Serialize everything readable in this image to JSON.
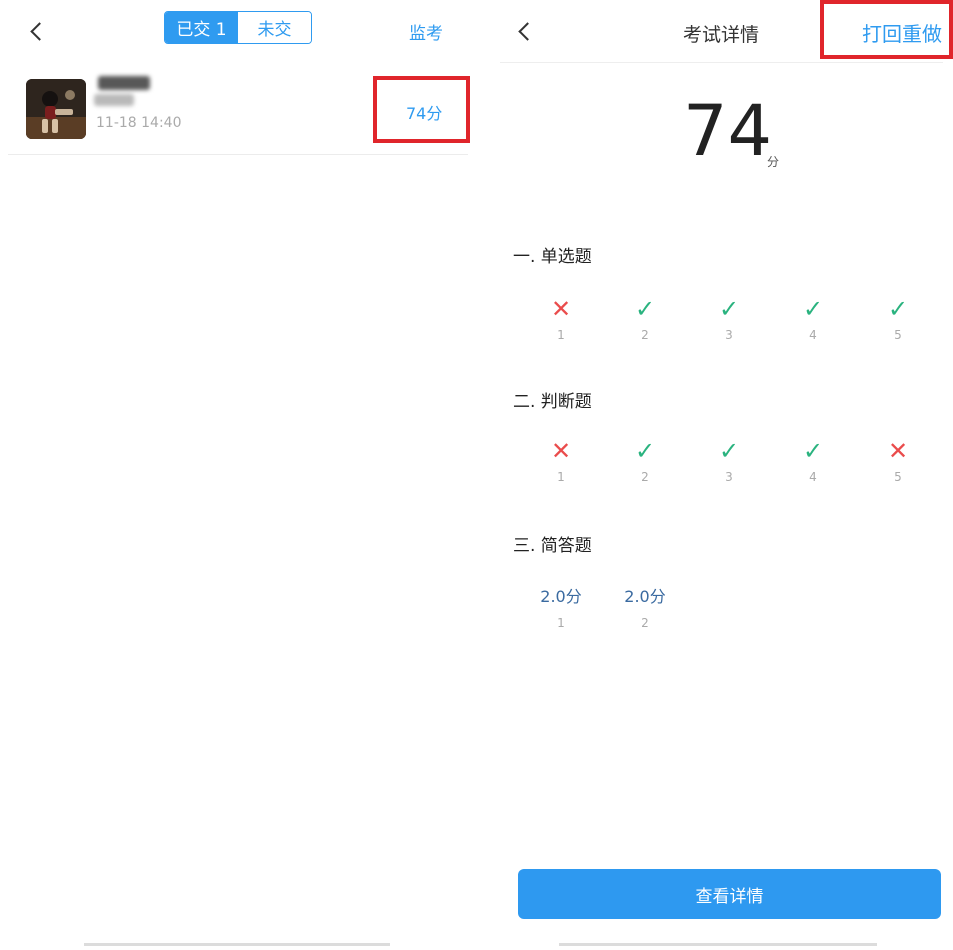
{
  "left": {
    "segment": {
      "submitted_label": "已交 1",
      "unsubmitted_label": "未交"
    },
    "proctor_label": "监考",
    "student": {
      "time": "11-18 14:40",
      "score": "74分"
    }
  },
  "right": {
    "header": {
      "title": "考试详情",
      "regrade_label": "打回重做"
    },
    "total": {
      "score": "74",
      "unit": "分"
    },
    "sections": [
      {
        "title": "一. 单选题",
        "questions": [
          {
            "num": "1",
            "mark": "✕",
            "status": "wrong"
          },
          {
            "num": "2",
            "mark": "✓",
            "status": "correct"
          },
          {
            "num": "3",
            "mark": "✓",
            "status": "correct"
          },
          {
            "num": "4",
            "mark": "✓",
            "status": "correct"
          },
          {
            "num": "5",
            "mark": "✓",
            "status": "correct"
          }
        ]
      },
      {
        "title": "二. 判断题",
        "questions": [
          {
            "num": "1",
            "mark": "✕",
            "status": "wrong"
          },
          {
            "num": "2",
            "mark": "✓",
            "status": "correct"
          },
          {
            "num": "3",
            "mark": "✓",
            "status": "correct"
          },
          {
            "num": "4",
            "mark": "✓",
            "status": "correct"
          },
          {
            "num": "5",
            "mark": "✕",
            "status": "wrong"
          }
        ]
      },
      {
        "title": "三. 简答题",
        "questions": [
          {
            "num": "1",
            "score": "2.0分"
          },
          {
            "num": "2",
            "score": "2.0分"
          }
        ]
      }
    ],
    "detail_button_label": "查看详情"
  },
  "colors": {
    "accent": "#2f9bf0",
    "correct": "#2ab37f",
    "wrong": "#ea4c4c",
    "highlight_box": "#e0252b"
  }
}
